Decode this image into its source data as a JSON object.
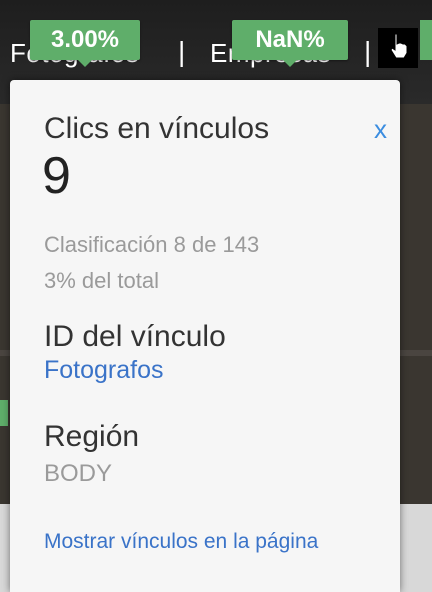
{
  "background": {
    "nav_links": [
      "Fotografos",
      "Empresas"
    ]
  },
  "badges": {
    "first": "3.00%",
    "second": "NaN%"
  },
  "popup": {
    "title": "Clics en vínculos",
    "close_label": "x",
    "count": "9",
    "rank": "Clasificación 8 de 143",
    "share": "3% del total",
    "link_id_label": "ID del vínculo",
    "link_id_value": "Fotografos",
    "region_label": "Región",
    "region_value": "BODY",
    "show_links": "Mostrar vínculos en la página"
  },
  "colors": {
    "badge": "#5fae6a",
    "link": "#3a73c8",
    "close": "#3b8de0"
  }
}
